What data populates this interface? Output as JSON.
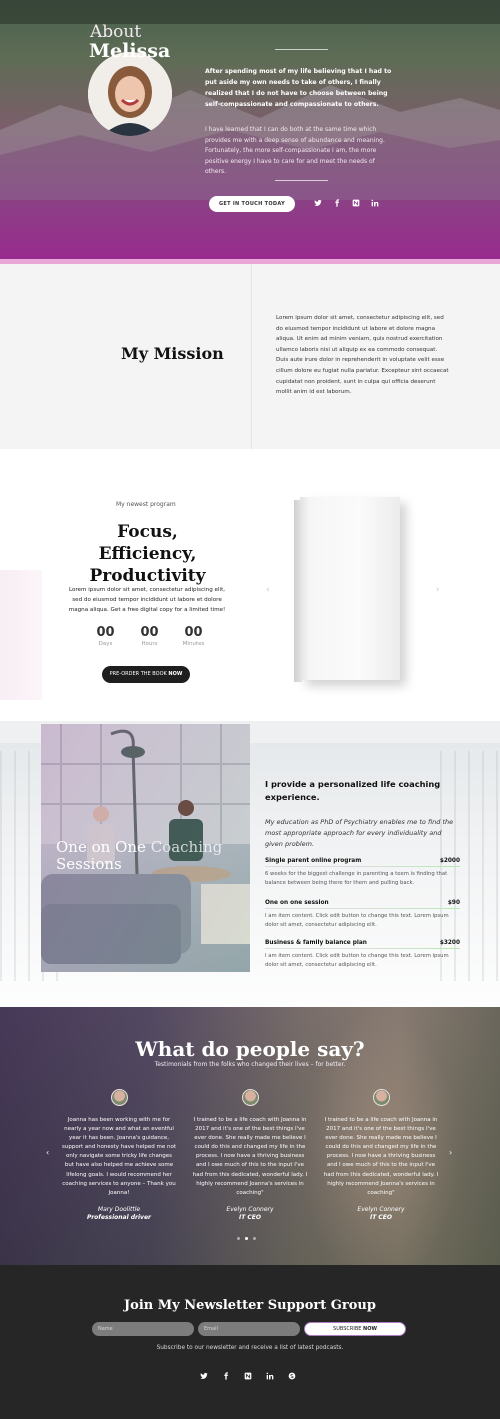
{
  "about": {
    "title_line1": "About",
    "title_line2": "Melissa",
    "paragraph1": "After spending most of my life believing that I had to put aside my own needs to take of others, I finally realized that I do not have to choose between being self-compassionate and compassionate to others.",
    "paragraph2": "I have learned that I can do both at the same time which provides me with a deep sense of abundance and meaning. Fortunately, the more self-compassionate I am, the more positive energy I have to care for and meet the needs of others.",
    "cta_label": "GET IN TOUCH TODAY",
    "social": [
      "twitter-icon",
      "facebook-icon",
      "newsletter-icon",
      "linkedin-icon"
    ]
  },
  "mission": {
    "title": "My Mission",
    "text": "Lorem ipsum dolor sit amet, consectetur adipiscing elit, sed do eiusmod tempor incididunt ut labore et dolore magna aliqua. Ut enim ad minim veniam, quis nostrud exercitation ullamco laboris nisi ut aliquip ex ea commodo consequat. Duis aute irure dolor in reprehenderit in voluptate velit esse cillum dolore eu fugiat nulla pariatur. Excepteur sint occaecat cupidatat non proident, sunt in culpa qui officia deserunt mollit anim id est laborum."
  },
  "program": {
    "subtitle": "My newest program",
    "title": "Focus, Efficiency, Productivity",
    "text": "Lorem ipsum dolor sit amet, consectetur adipiscing elit, sed do eiusmod tempor incididunt ut labore et dolore magna aliqua. Get a free digital copy for a limited time!",
    "countdown": [
      {
        "value": "00",
        "label": "Days"
      },
      {
        "value": "00",
        "label": "Hours"
      },
      {
        "value": "00",
        "label": "Minutes"
      }
    ],
    "order_label": "PRE-ORDER THE BOOK",
    "order_label_strong": "NOW"
  },
  "coaching": {
    "image_title_bold": "One on One",
    "image_title_light": "Coaching",
    "image_title_line2": "Sessions",
    "heading": "I provide a personalized life coaching experience.",
    "intro": "My education as PhD of Psychiatry enables me to find the most appropriate approach for every individuality and given problem.",
    "items": [
      {
        "name": "Single parent online program",
        "price": "$2000",
        "desc": "6 weeks for the biggest challenge in parenting a teem is finding that balance between being there for them and pulling back."
      },
      {
        "name": "One on one session",
        "price": "$90",
        "desc": "I am item content. Click edit button to change this text. Lorem ipsum dolor sit amet, consectetur adipiscing elit."
      },
      {
        "name": "Business & family balance plan",
        "price": "$3200",
        "desc": "I am item content. Click edit button to change this text. Lorem ipsum dolor sit amet, consectetur adipiscing elit."
      }
    ]
  },
  "testimonials": {
    "title": "What do people say?",
    "subtitle": "Testimonials from the folks who changed their lives – for better.",
    "cards": [
      {
        "text": "Joanna has been working with me for nearly a year now and what an eventful year it has been. Joanna's guidance, support and honesty have helped me not only navigate some tricky life changes but have also helped me achieve some lifelong goals. I would recommend her coaching services to anyone – Thank you Joanna!",
        "name": "Mary Doolittle",
        "role": "Professional driver"
      },
      {
        "text": "I trained to be a life coach with Joanna in 2017 and it's one of the best things I've ever done. She really made me believe I could do this and changed my life in the process. I now have a thriving business and I owe much of this to the input I've had from this dedicated, wonderful lady. I highly recommend Joanna's services in coaching\"",
        "name": "Evelyn Connery",
        "role": "IT CEO"
      },
      {
        "text": "I trained to be a life coach with Joanna in 2017 and it's one of the best things I've ever done. She really made me believe I could do this and changed my life in the process. I now have a thriving business and I owe much of this to the input I've had from this dedicated, wonderful lady. I highly recommend Joanna's services in coaching\"",
        "name": "Evelyn Connery",
        "role": "IT CEO"
      }
    ],
    "prev_arrow": "‹",
    "next_arrow": "›"
  },
  "newsletter": {
    "title": "Join My Newsletter Support Group",
    "name_placeholder": "Name",
    "email_placeholder": "Email",
    "subscribe_label": "SUBSCRIBE",
    "subscribe_label_strong": "NOW",
    "text": "Subscribe to our newsletter and receive a list of latest podcasts.",
    "social": [
      "twitter-icon",
      "facebook-icon",
      "newsletter-icon",
      "linkedin-icon",
      "skype-icon"
    ]
  }
}
